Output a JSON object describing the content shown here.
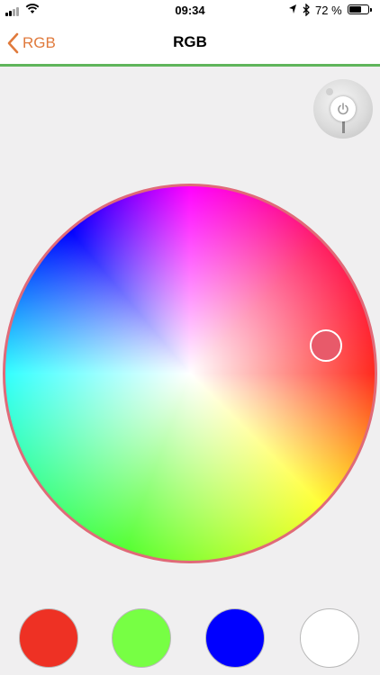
{
  "status_bar": {
    "time": "09:34",
    "battery_percent": "72 %",
    "battery_level": 0.72,
    "icons": [
      "signal-icon",
      "wifi-icon",
      "location-arrow-icon",
      "bluetooth-icon",
      "battery-icon"
    ]
  },
  "nav": {
    "back_label": "RGB",
    "title": "RGB"
  },
  "colors": {
    "accent_orange": "#e07a3c",
    "nav_border_green": "#5fb55b",
    "wheel_border": "#e06a78",
    "selected_color": "#e85a6a",
    "background": "#f0eff0"
  },
  "swatches": [
    {
      "name": "red",
      "color": "#ee3124"
    },
    {
      "name": "green",
      "color": "#77ff44"
    },
    {
      "name": "blue",
      "color": "#0000ff"
    },
    {
      "name": "white",
      "color": "#ffffff"
    }
  ]
}
